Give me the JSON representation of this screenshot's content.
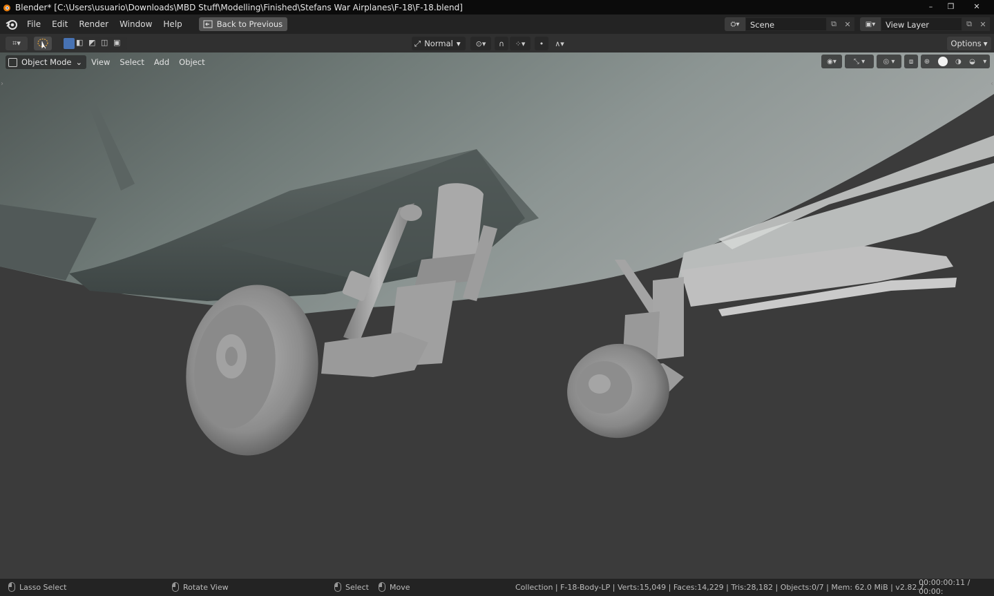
{
  "window": {
    "title": "Blender* [C:\\Users\\usuario\\Downloads\\MBD Stuff\\Modelling\\Finished\\Stefans War Airplanes\\F-18\\F-18.blend]",
    "controls": [
      "–",
      "❐",
      "✕"
    ]
  },
  "menu": {
    "items": [
      "File",
      "Edit",
      "Render",
      "Window",
      "Help"
    ],
    "back_label": "Back to Previous"
  },
  "scene": {
    "name": "Scene"
  },
  "view_layer": {
    "name": "View Layer"
  },
  "toolbar": {
    "orientation": "Normal",
    "options_label": "Options"
  },
  "viewport": {
    "mode": "Object Mode",
    "menus": [
      "View",
      "Select",
      "Add",
      "Object"
    ]
  },
  "status": {
    "lasso": "Lasso Select",
    "rotate": "Rotate View",
    "select": "Select",
    "move": "Move",
    "info": "Collection | F-18-Body-LP | Verts:15,049 | Faces:14,229 | Tris:28,182 | Objects:0/7 | Mem: 62.0 MiB | v2.82.7",
    "time": "00:00:00:11 / 00:00:"
  },
  "colors": {
    "accent": "#4772b3",
    "viewport_bg": "#3b3b3b",
    "header_bg": "#303030"
  }
}
